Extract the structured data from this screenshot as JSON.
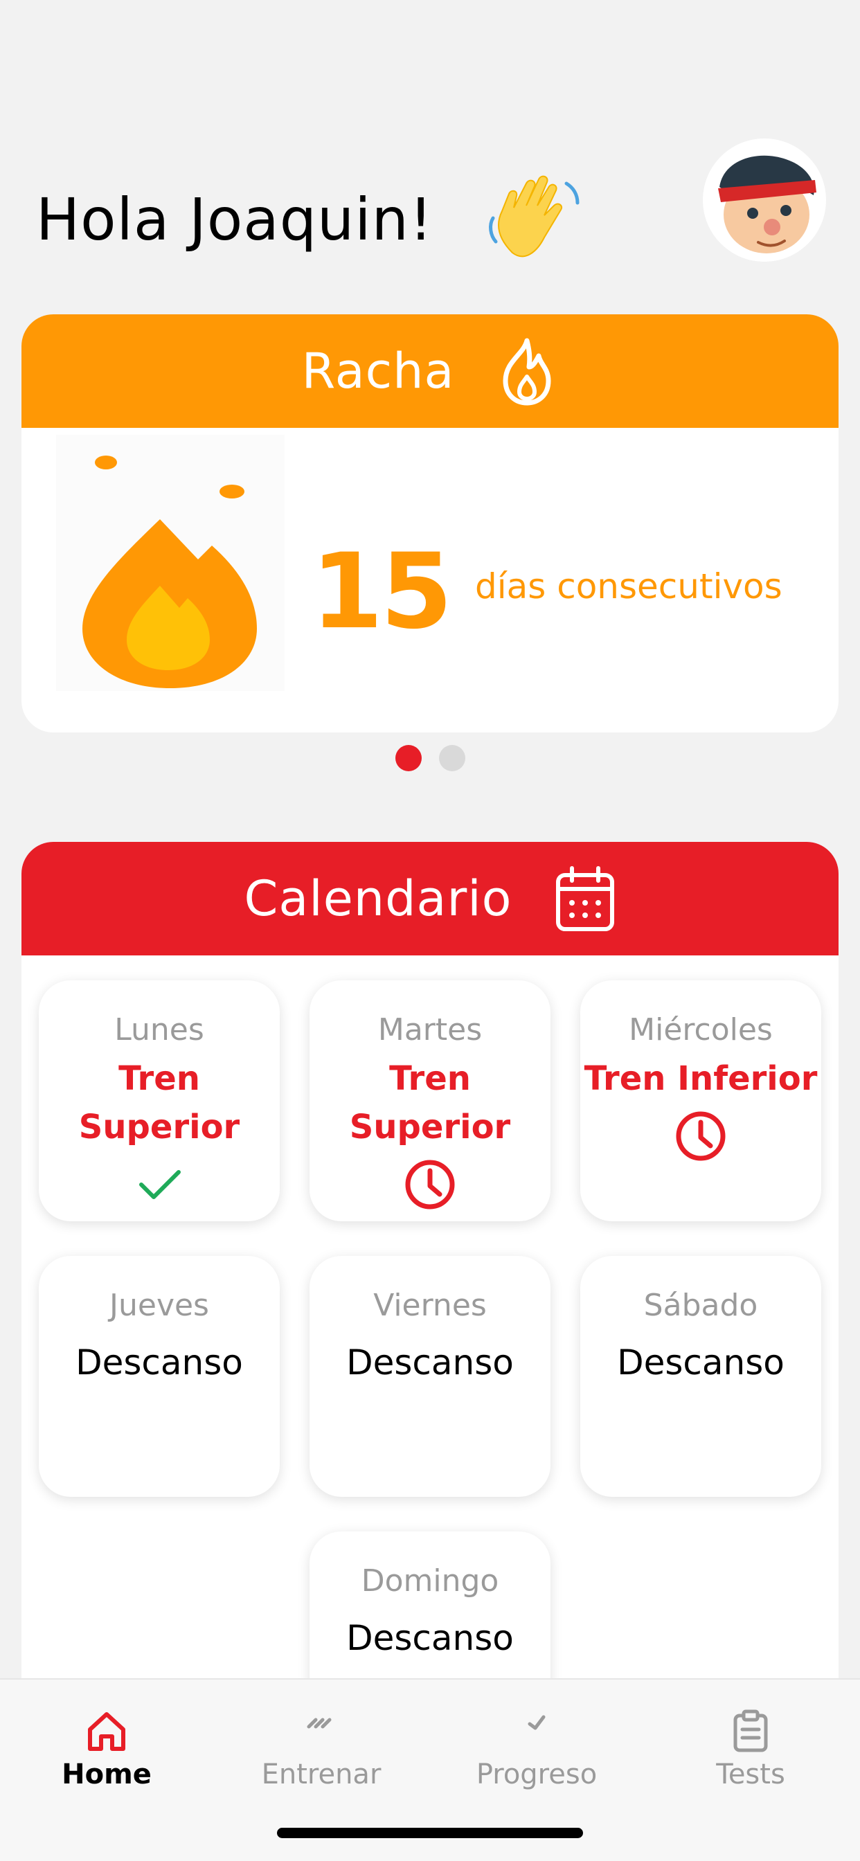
{
  "header": {
    "greeting": "Hola Joaquin!",
    "wave_icon": "waving-hand-icon",
    "avatar_icon": "user-avatar-icon"
  },
  "streak": {
    "title": "Racha",
    "title_icon": "flame-icon",
    "count": "15",
    "label": "días consecutivos",
    "color": "#ff9805"
  },
  "carousel": {
    "pages": 2,
    "active_index": 0
  },
  "calendar": {
    "title": "Calendario",
    "title_icon": "calendar-icon",
    "color": "#e71e27",
    "days": [
      {
        "name": "Lunes",
        "workout": "Tren Superior",
        "status": "done"
      },
      {
        "name": "Martes",
        "workout": "Tren Superior",
        "status": "pending"
      },
      {
        "name": "Miércoles",
        "workout": "Tren Inferior",
        "status": "pending"
      },
      {
        "name": "Jueves",
        "rest": "Descanso"
      },
      {
        "name": "Viernes",
        "rest": "Descanso"
      },
      {
        "name": "Sábado",
        "rest": "Descanso"
      },
      {
        "name": "Domingo",
        "rest": "Descanso"
      }
    ]
  },
  "bottom_nav": {
    "items": [
      {
        "label": "Home",
        "icon": "home-icon",
        "active": true
      },
      {
        "label": "Entrenar",
        "icon": "dumbbell-icon",
        "active": false
      },
      {
        "label": "Progreso",
        "icon": "chart-icon",
        "active": false
      },
      {
        "label": "Tests",
        "icon": "clipboard-icon",
        "active": false
      }
    ]
  }
}
